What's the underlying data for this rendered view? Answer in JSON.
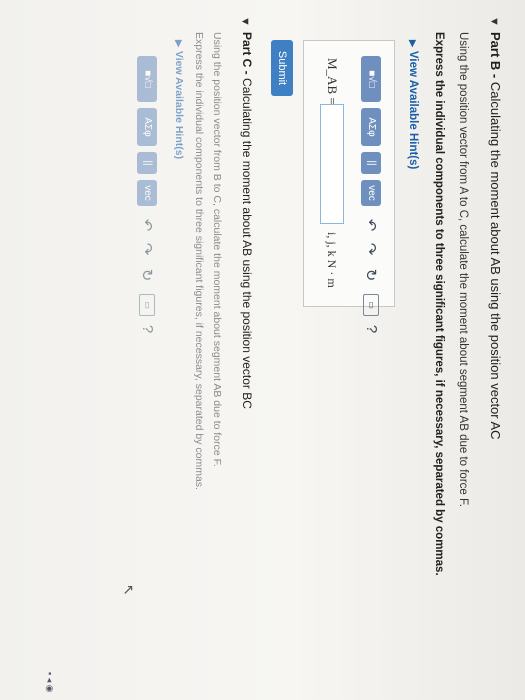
{
  "part_b": {
    "label": "Part B -",
    "heading": "Calculating the moment about AB using the position vector AC",
    "instruction": "Using the position vector from A to C, calculate the moment about segment AB due to force F.",
    "express": "Express the individual components to three significant figures, if necessary, separated by commas.",
    "hints_link": "View Available Hint(s)"
  },
  "toolbar": {
    "template": "■√□",
    "greek": "ΑΣφ",
    "pause": "||",
    "vec": "vec",
    "undo": "↶",
    "redo": "↷",
    "reset": "↻",
    "keyboard": "▭",
    "help": "?"
  },
  "answer": {
    "label": "M_AB =",
    "value": "",
    "units": "i, j, k  N · m",
    "submit": "Submit"
  },
  "part_c": {
    "label": "Part C -",
    "heading": "Calculating the moment about AB using the position vector BC",
    "instruction": "Using the position vector from B to C, calculate the moment about segment AB due to force F.",
    "express": "Express the individual components to three significant figures, if necessary, separated by commas.",
    "hints_link": "View Available Hint(s)"
  }
}
